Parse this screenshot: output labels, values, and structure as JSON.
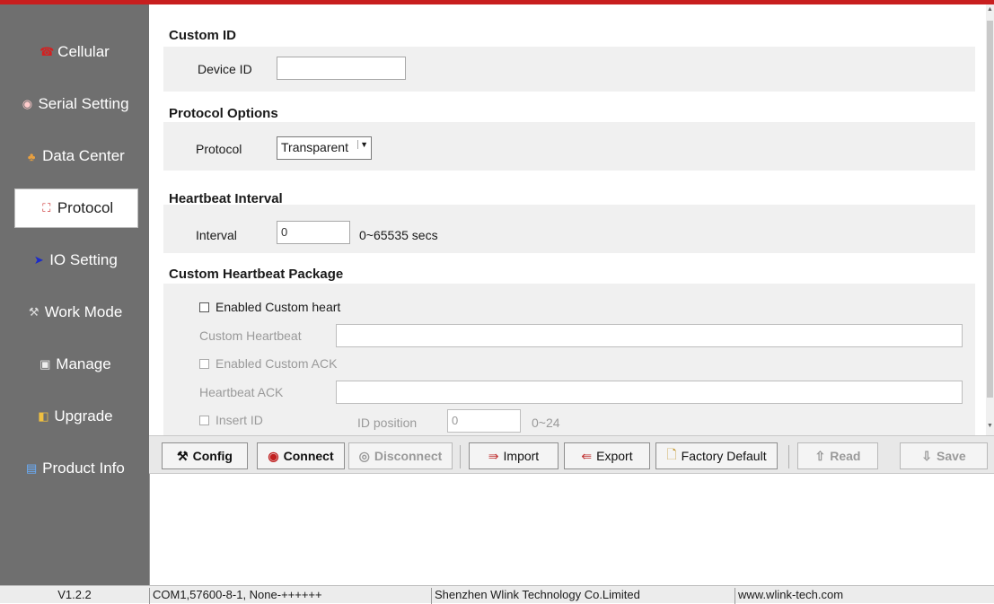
{
  "sidebar": {
    "items": [
      {
        "label": "Cellular",
        "icon": "phone-icon"
      },
      {
        "label": "Serial Setting",
        "icon": "serial-port-icon"
      },
      {
        "label": "Data Center",
        "icon": "network-icon"
      },
      {
        "label": "Protocol",
        "icon": "protocol-icon",
        "active": true
      },
      {
        "label": "IO Setting",
        "icon": "arrow-right-icon"
      },
      {
        "label": "Work Mode",
        "icon": "tools-icon"
      },
      {
        "label": "Manage",
        "icon": "monitor-icon"
      },
      {
        "label": "Upgrade",
        "icon": "upgrade-icon"
      },
      {
        "label": "Product Info",
        "icon": "info-card-icon"
      }
    ]
  },
  "custom_id": {
    "title": "Custom ID",
    "device_id_label": "Device ID",
    "device_id_value": ""
  },
  "protocol_options": {
    "title": "Protocol Options",
    "protocol_label": "Protocol",
    "protocol_value": "Transparent"
  },
  "heartbeat_interval": {
    "title": "Heartbeat Interval",
    "interval_label": "Interval",
    "interval_value": "0",
    "range_hint": "0~65535 secs"
  },
  "custom_heartbeat": {
    "title": "Custom Heartbeat Package",
    "enable_label": "Enabled Custom heart",
    "heartbeat_label": "Custom Heartbeat",
    "heartbeat_value": "",
    "enable_ack_label": "Enabled Custom ACK",
    "ack_label": "Heartbeat ACK",
    "ack_value": "",
    "insert_id_label": "Insert ID",
    "id_position_label": "ID position",
    "id_position_value": "0",
    "id_position_hint": "0~24"
  },
  "toolbar": {
    "config": "Config",
    "connect": "Connect",
    "disconnect": "Disconnect",
    "import": "Import",
    "export": "Export",
    "factory_default": "Factory Default",
    "read": "Read",
    "save": "Save"
  },
  "status_bar": {
    "version": "V1.2.2",
    "port": "COM1,57600-8-1, None-++++++",
    "company": "Shenzhen Wlink Technology Co.Limited",
    "website": "www.wlink-tech.com"
  },
  "colors": {
    "accent_top_bar": "#c81e1e",
    "sidebar_bg": "#6f6f6f",
    "panel_bg": "#f0f0f0"
  }
}
